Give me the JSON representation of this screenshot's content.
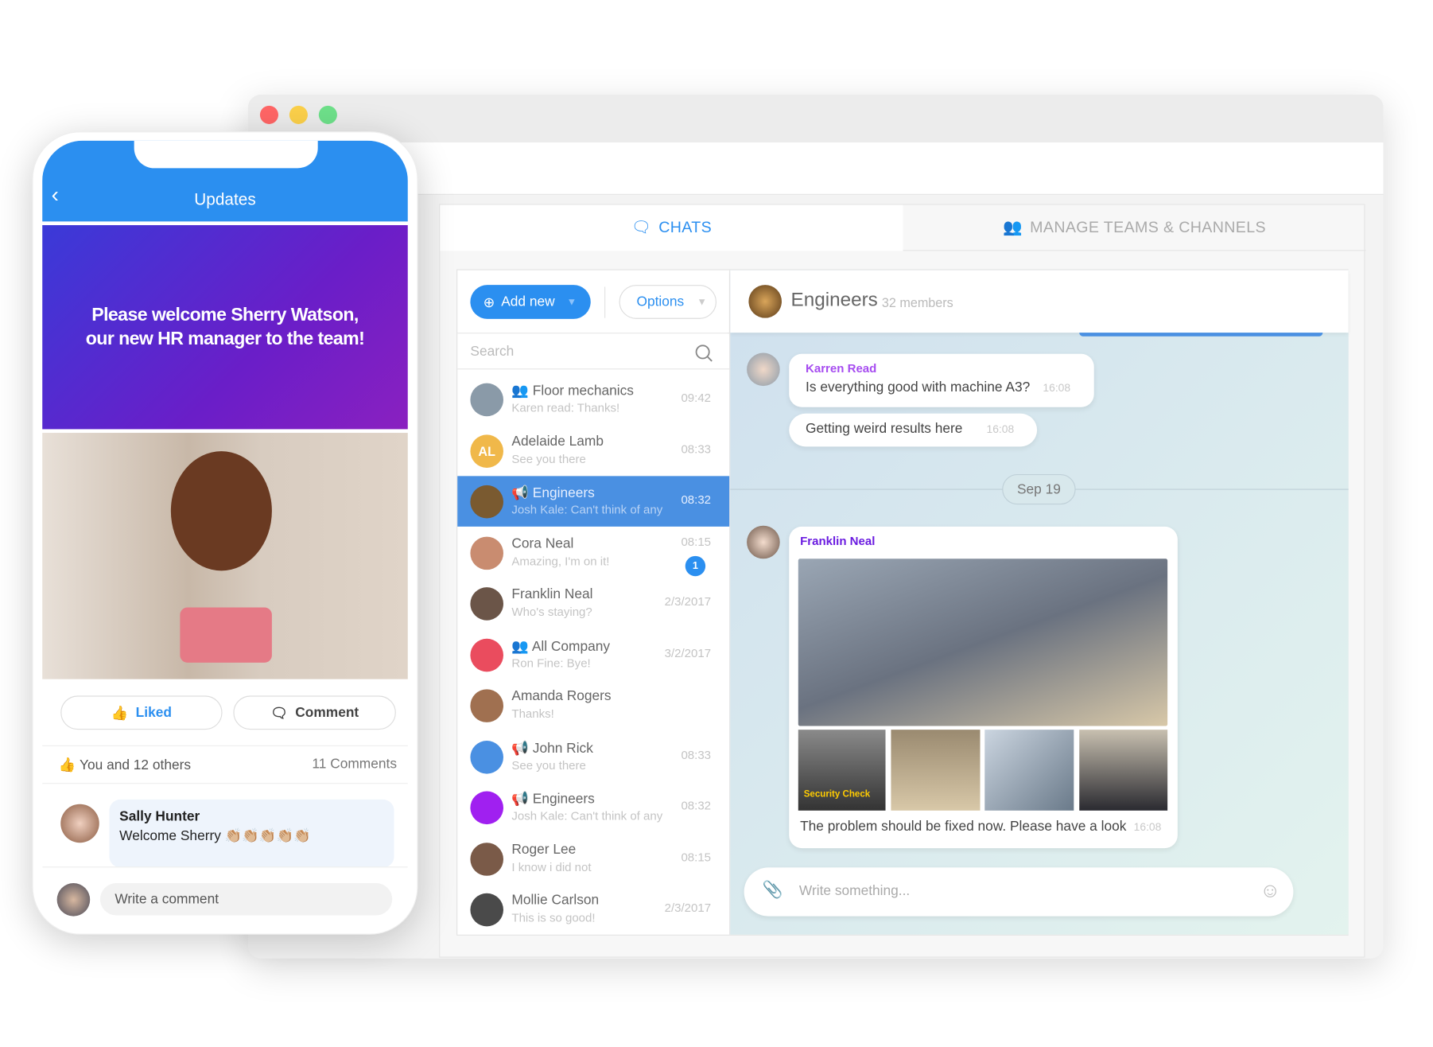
{
  "colors": {
    "accent": "#2b8ff0",
    "selected": "#4a90e2",
    "purple_name": "#a64cf0",
    "dark_purple_name": "#6a1be0"
  },
  "window": {
    "tabs": [
      {
        "label": "CHATS",
        "icon": "chat-bubbles-icon"
      },
      {
        "label": "MANAGE TEAMS & CHANNELS",
        "icon": "team-icon"
      }
    ]
  },
  "list": {
    "add_new": "Add new",
    "options": "Options",
    "search_placeholder": "Search",
    "items": [
      {
        "name": "Floor mechanics",
        "preview": "Karen read: Thanks!",
        "time": "09:42",
        "type": "group",
        "color": "#8a9aa8"
      },
      {
        "name": "Adelaide Lamb",
        "preview": "See you there",
        "time": "08:33",
        "initials": "AL",
        "color": "#f0b84a"
      },
      {
        "name": "Engineers",
        "preview": "Josh Kale: Can't think of any",
        "time": "08:32",
        "type": "channel",
        "color": "#7a5a30",
        "selected": true
      },
      {
        "name": "Cora Neal",
        "preview": "Amazing, I'm on it!",
        "time": "08:15",
        "badge": "1",
        "color": "#c98c70"
      },
      {
        "name": "Franklin Neal",
        "preview": "Who's staying?",
        "time": "2/3/2017",
        "color": "#6b5548"
      },
      {
        "name": "All Company",
        "preview": "Ron Fine: Bye!",
        "time": "3/2/2017",
        "type": "group",
        "color": "#ea4c5e"
      },
      {
        "name": "Amanda Rogers",
        "preview": "Thanks!",
        "time": "",
        "color": "#a07050"
      },
      {
        "name": "John Rick",
        "preview": "See you there",
        "time": "08:33",
        "type": "channel",
        "color": "#4a90e2"
      },
      {
        "name": "Engineers",
        "preview": "Josh Kale: Can't think of any",
        "time": "08:32",
        "type": "channel",
        "color": "#a020f0"
      },
      {
        "name": "Roger Lee",
        "preview": "I know i did not",
        "time": "08:15",
        "color": "#7a5a48"
      },
      {
        "name": "Mollie Carlson",
        "preview": "This is so good!",
        "time": "2/3/2017",
        "color": "#4a4a4a"
      }
    ]
  },
  "chat": {
    "title": "Engineers",
    "members": "32 members",
    "msg1": {
      "author": "Karren Read",
      "text": "Is everything good with machine A3?",
      "time": "16:08"
    },
    "msg2": {
      "text": "Getting weird results here",
      "time": "16:08"
    },
    "date": "Sep 19",
    "msg3": {
      "author": "Franklin Neal",
      "image_caption": "Security Check",
      "text": "The problem should be fixed now. Please have a look",
      "time": "16:08"
    },
    "input_placeholder": "Write something..."
  },
  "phone": {
    "title": "Updates",
    "banner": "Please welcome Sherry Watson, our new HR manager to the team!",
    "liked": "Liked",
    "comment": "Comment",
    "likes": "You and 12 others",
    "comments": "11 Comments",
    "comment_author": "Sally Hunter",
    "comment_text": "Welcome Sherry 👏🏼👏🏼👏🏼👏🏼👏🏼",
    "write_placeholder": "Write a comment"
  }
}
